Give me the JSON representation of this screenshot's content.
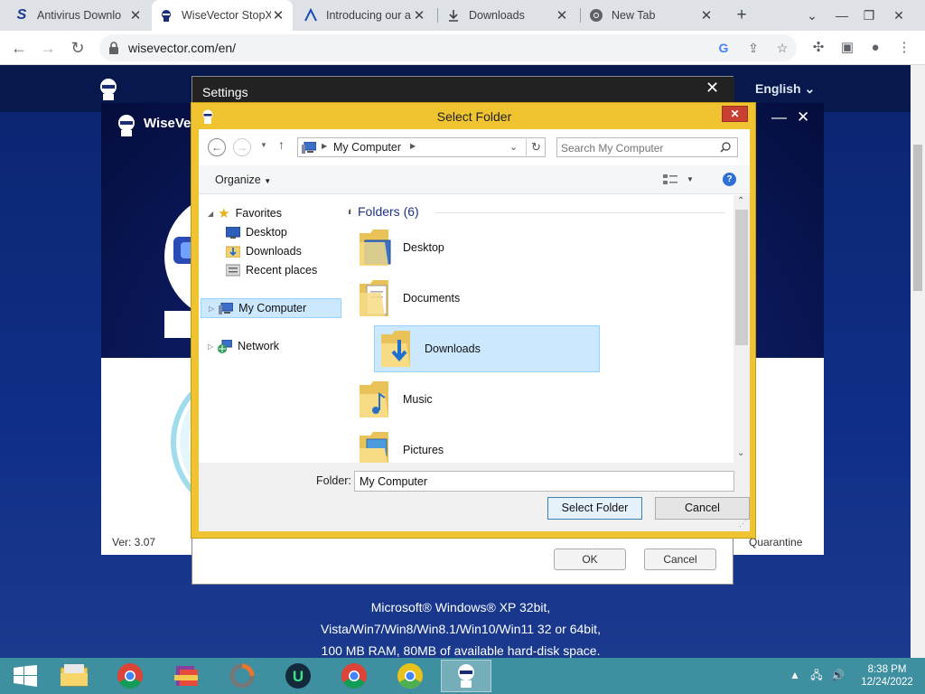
{
  "browser": {
    "tabs": [
      {
        "title": "Antivirus Downlo",
        "favicon": "s-icon",
        "active": false
      },
      {
        "title": "WiseVector StopX",
        "favicon": "wisevector-icon",
        "active": true
      },
      {
        "title": "Introducing our a",
        "favicon": "vector-a-icon",
        "active": false
      },
      {
        "title": "Downloads",
        "favicon": "download-icon",
        "active": false
      },
      {
        "title": "New Tab",
        "favicon": "chrome-icon",
        "active": false
      }
    ],
    "url": "wisevector.com/en/"
  },
  "website": {
    "language": "English",
    "footer_lines": [
      "Microsoft® Windows® XP 32bit,",
      "Vista/Win7/Win8/Win8.1/Win10/Win11 32 or 64bit,",
      "100 MB RAM, 80MB of available hard-disk space."
    ]
  },
  "app": {
    "name": "WiseVec",
    "version": "Ver: 3.07",
    "quarantine": "Quarantine"
  },
  "settings": {
    "title": "Settings",
    "ok_label": "OK",
    "cancel_label": "Cancel"
  },
  "dialog": {
    "title": "Select Folder",
    "address": "My Computer",
    "search_placeholder": "Search My Computer",
    "organize_label": "Organize",
    "nav": {
      "favorites_label": "Favorites",
      "favorites": [
        "Desktop",
        "Downloads",
        "Recent places"
      ],
      "computer_label": "My Computer",
      "network_label": "Network"
    },
    "group_header": "Folders (6)",
    "folders": [
      "Desktop",
      "Documents",
      "Downloads",
      "Music",
      "Pictures"
    ],
    "selected_folder": "Downloads",
    "folder_field_label": "Folder:",
    "folder_field_value": "My Computer",
    "select_button": "Select Folder",
    "cancel_button": "Cancel"
  },
  "taskbar": {
    "time": "8:38 PM",
    "date": "12/24/2022"
  },
  "colors": {
    "dialog_frame": "#efc430",
    "taskbar": "#3e8fa0",
    "site_bg": "#0f2e86",
    "selection": "#cce8ff"
  }
}
